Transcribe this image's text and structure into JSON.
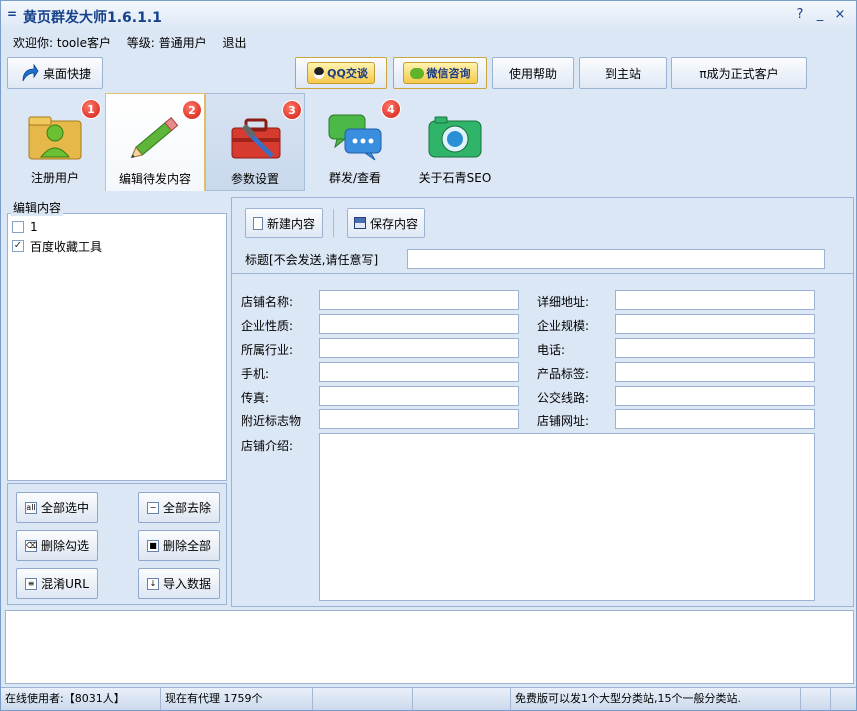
{
  "window": {
    "title": "黄页群发大师1.6.1.1",
    "sys_icon": "=",
    "controls": [
      "?",
      "_",
      "×"
    ]
  },
  "welcome": {
    "greeting": "欢迎你: toole客户",
    "level": "等级: 普通用户",
    "logout": "退出"
  },
  "toolbar": {
    "desktop_shortcut": "桌面快捷",
    "qq_chat": "QQ交谈",
    "wechat": "微信咨询",
    "help": "使用帮助",
    "main_site": "到主站",
    "become_customer": "π成为正式客户"
  },
  "tabs": [
    {
      "label": "注册用户",
      "badge": "1",
      "icon": "user-folder-icon"
    },
    {
      "label": "编辑待发内容",
      "badge": "2",
      "icon": "pencil-icon"
    },
    {
      "label": "参数设置",
      "badge": "3",
      "icon": "toolbox-icon"
    },
    {
      "label": "群发/查看",
      "badge": "4",
      "icon": "chat-bubbles-icon"
    },
    {
      "label": "关于石青SEO",
      "badge": "",
      "icon": "camera-icon"
    }
  ],
  "left_panel": {
    "group_title": "编辑内容",
    "items": [
      {
        "label": "1",
        "checked": false
      },
      {
        "label": "百度收藏工具",
        "checked": true
      }
    ],
    "buttons": {
      "select_all": "全部选中",
      "deselect_all": "全部去除",
      "delete_checked": "删除勾选",
      "delete_all": "删除全部",
      "mix_url": "混淆URL",
      "import_data": "导入数据"
    }
  },
  "right_panel": {
    "new_content": "新建内容",
    "save_content": "保存内容",
    "title_label": "标题[不会发送,请任意写]",
    "fields_left": [
      "店铺名称:",
      "企业性质:",
      "所属行业:",
      "手机:",
      "传真:",
      "附近标志物"
    ],
    "fields_right": [
      "详细地址:",
      "企业规模:",
      "电话:",
      "产品标签:",
      "公交线路:",
      "店铺网址:"
    ],
    "intro_label": "店铺介绍:"
  },
  "status": {
    "online_users": "在线使用者:【8031人】",
    "proxies": "现在有代理 1759个",
    "notice": "免费版可以发1个大型分类站,15个一般分类站."
  }
}
